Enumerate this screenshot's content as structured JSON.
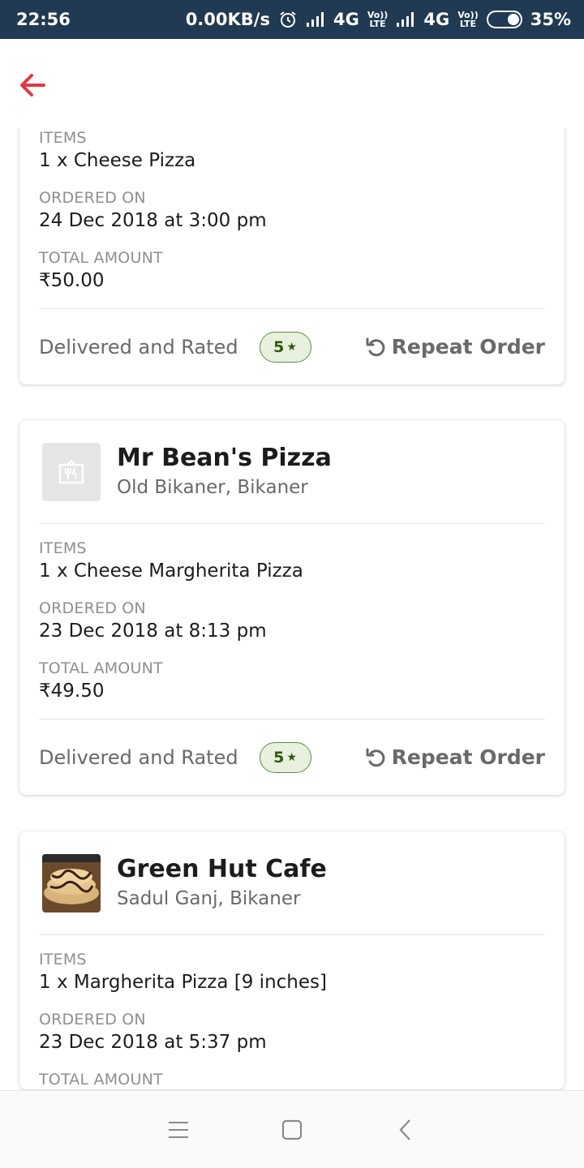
{
  "status_bar": {
    "time": "22:56",
    "speed": "0.00KB/s",
    "net1": "4G",
    "volte1_top": "Vo))",
    "volte1_bottom": "LTE",
    "net2": "4G",
    "volte2_top": "Vo))",
    "volte2_bottom": "LTE",
    "battery": "35%"
  },
  "header": {
    "back_icon": "arrow-left-icon",
    "accent_color": "#e23744"
  },
  "labels": {
    "items": "ITEMS",
    "ordered_on": "ORDERED ON",
    "total_amount": "TOTAL AMOUNT",
    "status": "Delivered and Rated",
    "repeat": "Repeat Order",
    "star": "★"
  },
  "orders": [
    {
      "items": "1 x Cheese Pizza",
      "ordered_on": "24 Dec 2018 at 3:00 pm",
      "total": "₹50.00",
      "rating": "5"
    },
    {
      "restaurant": "Mr Bean's Pizza",
      "location": "Old Bikaner, Bikaner",
      "thumb": "restaurant-placeholder-icon",
      "items": "1 x Cheese Margherita Pizza",
      "ordered_on": "23 Dec 2018 at 8:13 pm",
      "total": "₹49.50",
      "rating": "5"
    },
    {
      "restaurant": "Green Hut Cafe",
      "location": "Sadul Ganj, Bikaner",
      "thumb": "food-photo",
      "items": "1 x Margherita Pizza [9 inches]",
      "ordered_on": "23 Dec 2018 at 5:37 pm"
    }
  ],
  "nav": {
    "menu_icon": "menu-icon",
    "home_icon": "home-square-icon",
    "back_icon": "back-chevron-icon"
  }
}
